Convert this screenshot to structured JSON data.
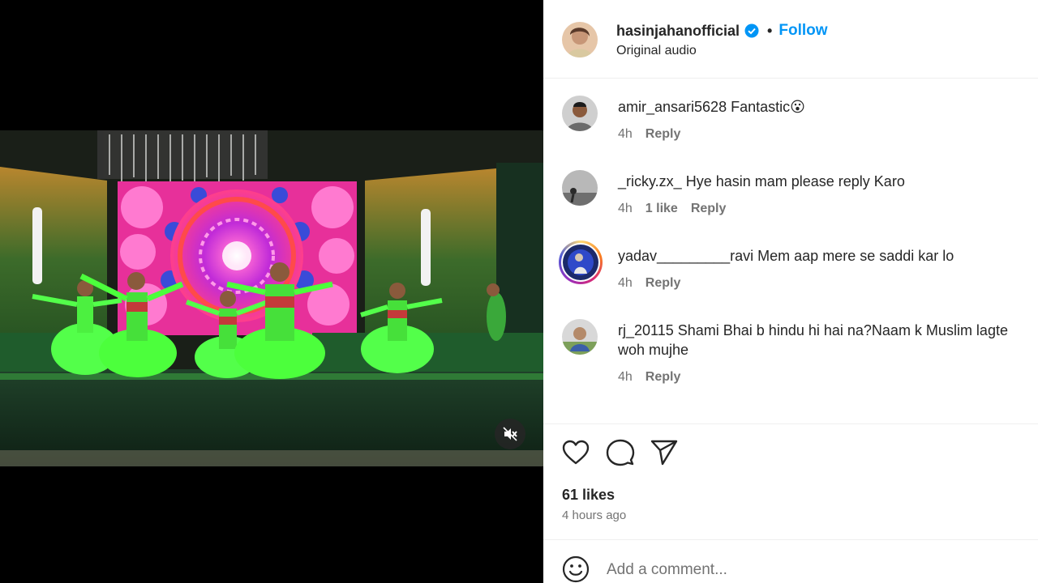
{
  "media": {
    "mute_icon": "speaker-muted-icon",
    "colors": {
      "letterbox": "#000000",
      "stage_green": "#2e7d3a",
      "costume_green": "#4cff3c",
      "screen_pink": "#ff3fa8"
    }
  },
  "post": {
    "username": "hasinjahanofficial",
    "verified": true,
    "follow_label": "Follow",
    "separator": "•",
    "audio": "Original audio"
  },
  "comments": [
    {
      "user": "amir_ansari5628",
      "text": "Fantastic😮",
      "time": "4h",
      "likes": "",
      "reply": "Reply"
    },
    {
      "user": "_ricky.zx_",
      "text": "Hye hasin mam please reply Karo",
      "time": "4h",
      "likes": "1 like",
      "reply": "Reply"
    },
    {
      "user": "yadav_________ravi",
      "text": "Mem aap mere se saddi kar lo",
      "time": "4h",
      "likes": "",
      "reply": "Reply"
    },
    {
      "user": "rj_20115",
      "text": "Shami Bhai b hindu hi hai na?Naam k Muslim lagte woh mujhe",
      "time": "4h",
      "likes": "",
      "reply": "Reply"
    }
  ],
  "actions": {
    "icons": [
      "heart-icon",
      "comment-icon",
      "share-icon"
    ]
  },
  "stats": {
    "likes": "61 likes",
    "posted": "4 hours ago"
  },
  "composer": {
    "placeholder": "Add a comment...",
    "emoji_icon": "smiley-icon"
  },
  "colors": {
    "accent": "#0095f6",
    "verified": "#0095f6",
    "text": "#262626",
    "muted": "#737373"
  }
}
